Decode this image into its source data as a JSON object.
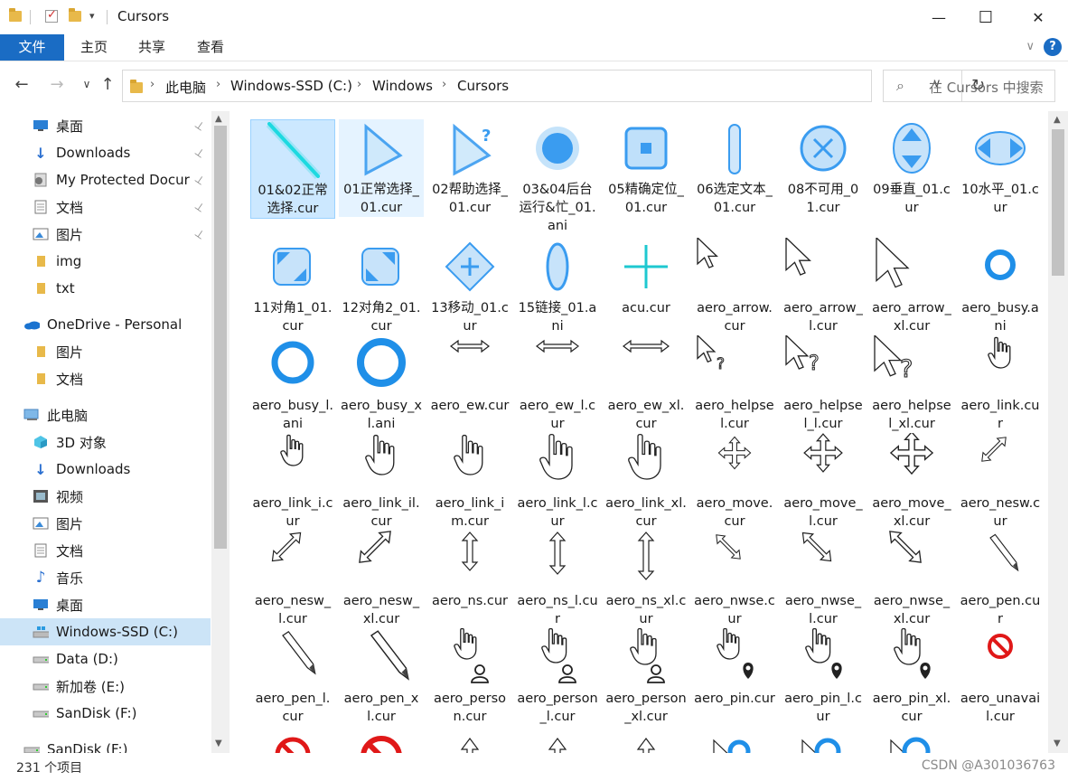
{
  "window": {
    "title": "Cursors",
    "quick_access_dropdown": "▾",
    "minimize": "—",
    "maximize": "☐",
    "close": "✕"
  },
  "ribbon": {
    "tabs": [
      "文件",
      "主页",
      "共享",
      "查看"
    ],
    "help": "?",
    "expand": "∨"
  },
  "nav": {
    "back": "←",
    "forward": "→",
    "recent": "∨",
    "up": "↑"
  },
  "address": {
    "breadcrumbs": [
      "此电脑",
      "Windows-SSD (C:)",
      "Windows",
      "Cursors"
    ],
    "separator": "›",
    "dropdown": "∨",
    "refresh": "↻"
  },
  "search": {
    "placeholder": "在 Cursors 中搜索",
    "icon": "⌕"
  },
  "navpane": {
    "items": [
      {
        "label": "桌面",
        "icon": "desktop-icon",
        "pinned": true
      },
      {
        "label": "Downloads",
        "icon": "download-icon",
        "pinned": true
      },
      {
        "label": "My Protected Docur",
        "icon": "protected-docs-icon",
        "pinned": true
      },
      {
        "label": "文档",
        "icon": "document-icon",
        "pinned": true
      },
      {
        "label": "图片",
        "icon": "picture-icon",
        "pinned": true
      },
      {
        "label": "img",
        "icon": "folder-icon",
        "pinned": false
      },
      {
        "label": "txt",
        "icon": "folder-icon",
        "pinned": false
      },
      {
        "label": "OneDrive - Personal",
        "icon": "onedrive-icon",
        "pinned": false
      },
      {
        "label": "图片",
        "icon": "folder-icon",
        "pinned": false
      },
      {
        "label": "文档",
        "icon": "folder-icon",
        "pinned": false
      },
      {
        "label": "此电脑",
        "icon": "this-pc-icon",
        "pinned": false
      },
      {
        "label": "3D 对象",
        "icon": "3d-objects-icon",
        "pinned": false
      },
      {
        "label": "Downloads",
        "icon": "download-icon",
        "pinned": false
      },
      {
        "label": "视频",
        "icon": "video-icon",
        "pinned": false
      },
      {
        "label": "图片",
        "icon": "picture-icon",
        "pinned": false
      },
      {
        "label": "文档",
        "icon": "document-icon",
        "pinned": false
      },
      {
        "label": "音乐",
        "icon": "music-icon",
        "pinned": false
      },
      {
        "label": "桌面",
        "icon": "desktop-icon",
        "pinned": false
      },
      {
        "label": "Windows-SSD (C:)",
        "icon": "windows-drive-icon",
        "pinned": false,
        "selected": true
      },
      {
        "label": "Data (D:)",
        "icon": "drive-icon",
        "pinned": false
      },
      {
        "label": "新加卷 (E:)",
        "icon": "drive-icon",
        "pinned": false
      },
      {
        "label": "SanDisk (F:)",
        "icon": "drive-icon",
        "pinned": false
      },
      {
        "label": "SanDisk (F:)",
        "icon": "drive-icon",
        "pinned": false
      }
    ],
    "pin_glyph": "📌"
  },
  "files": [
    {
      "name": "01&02正常选择.cur",
      "icon": "diag-line",
      "color": "#17d9e0",
      "state": "selected"
    },
    {
      "name": "01正常选择_01.cur",
      "icon": "glow-arrow",
      "color": "#3a9cf0",
      "state": "highlighted"
    },
    {
      "name": "02帮助选择_01.cur",
      "icon": "glow-arrow-help",
      "color": "#3a9cf0"
    },
    {
      "name": "03&04后台运行&忙_01.ani",
      "icon": "glow-circle",
      "color": "#3a9cf0"
    },
    {
      "name": "05精确定位_01.cur",
      "icon": "glow-square",
      "color": "#3a9cf0"
    },
    {
      "name": "06选定文本_01.cur",
      "icon": "glow-bar",
      "color": "#3a9cf0"
    },
    {
      "name": "08不可用_01.cur",
      "icon": "glow-no",
      "color": "#3a9cf0"
    },
    {
      "name": "09垂直_01.cur",
      "icon": "glow-vert",
      "color": "#3a9cf0"
    },
    {
      "name": "10水平_01.cur",
      "icon": "glow-horz",
      "color": "#3a9cf0"
    },
    {
      "name": "11对角1_01.cur",
      "icon": "glow-diag1",
      "color": "#3a9cf0"
    },
    {
      "name": "12对角2_01.cur",
      "icon": "glow-diag2",
      "color": "#3a9cf0"
    },
    {
      "name": "13移动_01.cur",
      "icon": "glow-move",
      "color": "#3a9cf0"
    },
    {
      "name": "15链接_01.ani",
      "icon": "glow-oval",
      "color": "#3a9cf0"
    },
    {
      "name": "acu.cur",
      "icon": "cross",
      "color": "#1ec8d0"
    },
    {
      "name": "aero_arrow.cur",
      "icon": "arrow-s",
      "color": "#222"
    },
    {
      "name": "aero_arrow_l.cur",
      "icon": "arrow-m",
      "color": "#222"
    },
    {
      "name": "aero_arrow_xl.cur",
      "icon": "arrow-l",
      "color": "#222"
    },
    {
      "name": "aero_busy.ani",
      "icon": "ring-s",
      "color": "#1f8fe8"
    },
    {
      "name": "aero_busy_l.ani",
      "icon": "ring-m",
      "color": "#1f8fe8"
    },
    {
      "name": "aero_busy_xl.ani",
      "icon": "ring-l",
      "color": "#1f8fe8"
    },
    {
      "name": "aero_ew.cur",
      "icon": "ew-s",
      "color": "#222"
    },
    {
      "name": "aero_ew_l.cur",
      "icon": "ew-m",
      "color": "#222"
    },
    {
      "name": "aero_ew_xl.cur",
      "icon": "ew-l",
      "color": "#222"
    },
    {
      "name": "aero_helpsel.cur",
      "icon": "help-s",
      "color": "#222"
    },
    {
      "name": "aero_helpsel_l.cur",
      "icon": "help-m",
      "color": "#222"
    },
    {
      "name": "aero_helpsel_xl.cur",
      "icon": "help-l",
      "color": "#222"
    },
    {
      "name": "aero_link.cur",
      "icon": "hand-s",
      "color": "#222"
    },
    {
      "name": "aero_link_i.cur",
      "icon": "hand-s",
      "color": "#222"
    },
    {
      "name": "aero_link_il.cur",
      "icon": "hand-m",
      "color": "#222"
    },
    {
      "name": "aero_link_im.cur",
      "icon": "hand-m",
      "color": "#222"
    },
    {
      "name": "aero_link_l.cur",
      "icon": "hand-l",
      "color": "#222"
    },
    {
      "name": "aero_link_xl.cur",
      "icon": "hand-l",
      "color": "#222"
    },
    {
      "name": "aero_move.cur",
      "icon": "move-s",
      "color": "#222"
    },
    {
      "name": "aero_move_l.cur",
      "icon": "move-m",
      "color": "#222"
    },
    {
      "name": "aero_move_xl.cur",
      "icon": "move-l",
      "color": "#222"
    },
    {
      "name": "aero_nesw.cur",
      "icon": "nesw-s",
      "color": "#222"
    },
    {
      "name": "aero_nesw_l.cur",
      "icon": "nesw-m",
      "color": "#222"
    },
    {
      "name": "aero_nesw_xl.cur",
      "icon": "nesw-l",
      "color": "#222"
    },
    {
      "name": "aero_ns.cur",
      "icon": "ns-s",
      "color": "#222"
    },
    {
      "name": "aero_ns_l.cur",
      "icon": "ns-m",
      "color": "#222"
    },
    {
      "name": "aero_ns_xl.cur",
      "icon": "ns-l",
      "color": "#222"
    },
    {
      "name": "aero_nwse.cur",
      "icon": "nwse-s",
      "color": "#222"
    },
    {
      "name": "aero_nwse_l.cur",
      "icon": "nwse-m",
      "color": "#222"
    },
    {
      "name": "aero_nwse_xl.cur",
      "icon": "nwse-l",
      "color": "#222"
    },
    {
      "name": "aero_pen.cur",
      "icon": "pen-s",
      "color": "#222"
    },
    {
      "name": "aero_pen_l.cur",
      "icon": "pen-m",
      "color": "#222"
    },
    {
      "name": "aero_pen_xl.cur",
      "icon": "pen-l",
      "color": "#222"
    },
    {
      "name": "aero_person.cur",
      "icon": "person-s",
      "color": "#222"
    },
    {
      "name": "aero_person_l.cur",
      "icon": "person-m",
      "color": "#222"
    },
    {
      "name": "aero_person_xl.cur",
      "icon": "person-l",
      "color": "#222"
    },
    {
      "name": "aero_pin.cur",
      "icon": "pin-s",
      "color": "#222"
    },
    {
      "name": "aero_pin_l.cur",
      "icon": "pin-m",
      "color": "#222"
    },
    {
      "name": "aero_pin_xl.cur",
      "icon": "pin-l",
      "color": "#222"
    },
    {
      "name": "aero_unavail.cur",
      "icon": "unavail-s",
      "color": "#e01818"
    },
    {
      "name": "",
      "icon": "unavail-m",
      "color": "#e01818"
    },
    {
      "name": "",
      "icon": "unavail-l",
      "color": "#e01818"
    },
    {
      "name": "",
      "icon": "up-s",
      "color": "#222"
    },
    {
      "name": "",
      "icon": "up-m",
      "color": "#222"
    },
    {
      "name": "",
      "icon": "up-l",
      "color": "#222"
    },
    {
      "name": "",
      "icon": "working-s",
      "color": "#1f8fe8"
    },
    {
      "name": "",
      "icon": "working-m",
      "color": "#1f8fe8"
    },
    {
      "name": "",
      "icon": "working-l",
      "color": "#1f8fe8"
    }
  ],
  "status": {
    "count": "231 个项目"
  },
  "watermark": "CSDN @A301036763"
}
